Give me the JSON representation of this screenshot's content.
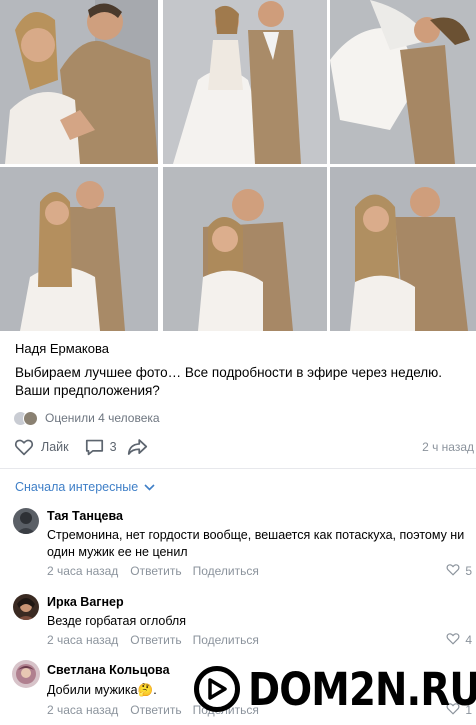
{
  "post": {
    "author": "Надя Ермакова",
    "text": "Выбираем лучшее фото… Все подробности в эфире через неделю. Ваши предположения?",
    "likes_summary": "Оценили 4 человека",
    "like_label": "Лайк",
    "comment_count": "3",
    "time": "2 ч назад",
    "photos": [
      {
        "subject": "couple-posing-1"
      },
      {
        "subject": "couple-posing-2"
      },
      {
        "subject": "couple-lift"
      },
      {
        "subject": "couple-posing-3"
      },
      {
        "subject": "couple-hug"
      },
      {
        "subject": "couple-posing-4"
      }
    ]
  },
  "comments_header": {
    "sort_label": "Сначала интересные"
  },
  "comments": [
    {
      "name": "Тая Танцева",
      "text": "Стремонина, нет гордости вообще, вешается как потаскуха, поэтому ни один мужик ее не ценил",
      "time": "2 часа назад",
      "reply": "Ответить",
      "share": "Поделиться",
      "likes": "5"
    },
    {
      "name": "Ирка Вагнер",
      "text": "Везде горбатая оглобля",
      "time": "2 часа назад",
      "reply": "Ответить",
      "share": "Поделиться",
      "likes": "4"
    },
    {
      "name": "Светлана Кольцова",
      "text": "Добили мужика",
      "emoji": "🤔",
      "time": "2 часа назад",
      "reply": "Ответить",
      "share": "Поделиться",
      "likes": "1"
    }
  ],
  "watermark": {
    "text": "DOM2N.RU"
  },
  "colors": {
    "link_blue": "#3f7fc7",
    "meta_gray": "#8b939c",
    "icon_gray": "#5d656f"
  }
}
